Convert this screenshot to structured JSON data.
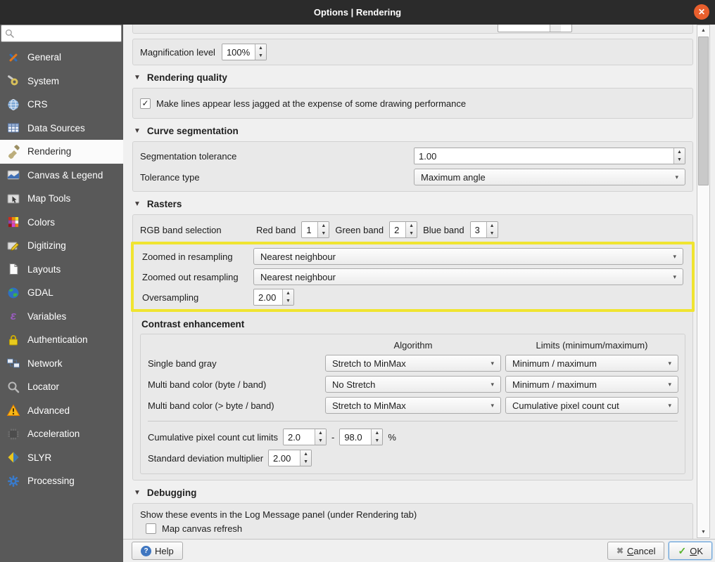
{
  "window": {
    "title": "Options | Rendering"
  },
  "icons": {
    "close": "✕",
    "section_collapse": "▼",
    "combo_arrow": "▾",
    "spin_up": "▲",
    "spin_down": "▼",
    "check": "✓",
    "help_glyph": "?",
    "cancel_glyph": "✖",
    "ok_glyph": "✓",
    "scroll_up": "▲",
    "scroll_down": "▼",
    "epsilon": "ε"
  },
  "colors": {
    "titlebar": "#2b2b2b",
    "close_button": "#e95f2d",
    "sidebar_bg": "#595959",
    "sidebar_selected_bg": "#fbfbfb",
    "content_bg": "#f0f0f0",
    "groupbox_bg": "#e9e9e9",
    "highlight_border": "#f0e431",
    "ok_focus_border": "#6ea3d8"
  },
  "sidebar": {
    "search_placeholder": "",
    "items": [
      {
        "label": "General"
      },
      {
        "label": "System"
      },
      {
        "label": "CRS"
      },
      {
        "label": "Data Sources"
      },
      {
        "label": "Rendering",
        "selected": true
      },
      {
        "label": "Canvas & Legend"
      },
      {
        "label": "Map Tools"
      },
      {
        "label": "Colors"
      },
      {
        "label": "Digitizing"
      },
      {
        "label": "Layouts"
      },
      {
        "label": "GDAL"
      },
      {
        "label": "Variables"
      },
      {
        "label": "Authentication"
      },
      {
        "label": "Network"
      },
      {
        "label": "Locator"
      },
      {
        "label": "Advanced"
      },
      {
        "label": "Acceleration"
      },
      {
        "label": "SLYR"
      },
      {
        "label": "Processing"
      }
    ]
  },
  "content": {
    "magnification": {
      "label": "Magnification level",
      "value": "100%"
    },
    "rendering_quality": {
      "title": "Rendering quality",
      "checkbox_label": "Make lines appear less jagged at the expense of some drawing performance",
      "checked": true
    },
    "curve_segmentation": {
      "title": "Curve segmentation",
      "tolerance_label": "Segmentation tolerance",
      "tolerance_value": "1.00",
      "type_label": "Tolerance type",
      "type_value": "Maximum angle"
    },
    "rasters": {
      "title": "Rasters",
      "rgb_label": "RGB band selection",
      "red_label": "Red band",
      "red_value": "1",
      "green_label": "Green band",
      "green_value": "2",
      "blue_label": "Blue band",
      "blue_value": "3",
      "zoomed_in_label": "Zoomed in resampling",
      "zoomed_in_value": "Nearest neighbour",
      "zoomed_out_label": "Zoomed out resampling",
      "zoomed_out_value": "Nearest neighbour",
      "oversampling_label": "Oversampling",
      "oversampling_value": "2.00"
    },
    "contrast": {
      "title": "Contrast enhancement",
      "algorithm_header": "Algorithm",
      "limits_header": "Limits (minimum/maximum)",
      "rows": [
        {
          "label": "Single band gray",
          "algorithm": "Stretch to MinMax",
          "limits": "Minimum / maximum"
        },
        {
          "label": "Multi band color (byte / band)",
          "algorithm": "No Stretch",
          "limits": "Minimum / maximum"
        },
        {
          "label": "Multi band color (> byte / band)",
          "algorithm": "Stretch to MinMax",
          "limits": "Cumulative pixel count cut"
        }
      ],
      "cut_limits_label": "Cumulative pixel count cut limits",
      "cut_min": "2.0",
      "cut_dash": "-",
      "cut_max": "98.0",
      "cut_unit": "%",
      "stddev_label": "Standard deviation multiplier",
      "stddev_value": "2.00"
    },
    "debugging": {
      "title": "Debugging",
      "note": "Show these events in the Log Message panel (under Rendering tab)",
      "checkbox_label": "Map canvas refresh",
      "checked": false
    }
  },
  "footer": {
    "help_label": "Help",
    "cancel_letter": "C",
    "cancel_rest": "ancel",
    "ok_letter": "O",
    "ok_rest": "K"
  }
}
